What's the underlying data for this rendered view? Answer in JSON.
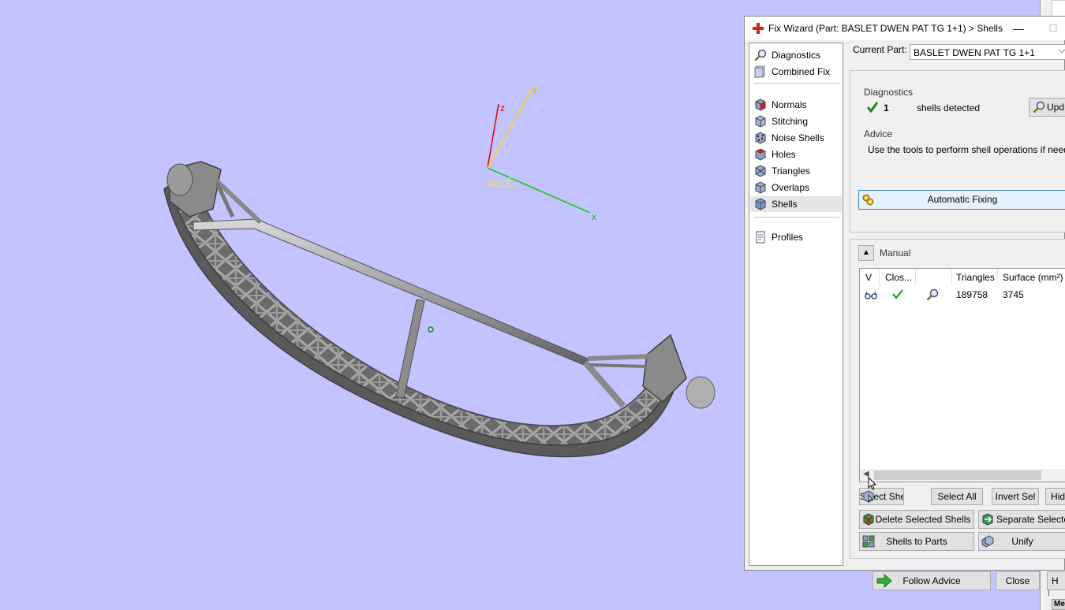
{
  "viewport": {
    "axes": {
      "z": "z",
      "y": "y",
      "x": "x",
      "wcs": "WCS"
    },
    "corner_axis": "x"
  },
  "window": {
    "title": "Fix Wizard (Part: BASLET  DWEN PAT TG 1+1) > Shells",
    "minimize": "—",
    "maximize": "☐"
  },
  "nav": {
    "top_items": [
      {
        "label": "Diagnostics",
        "icon": "magnifier-icon"
      },
      {
        "label": "Combined Fix",
        "icon": "combined-fix-icon"
      }
    ],
    "fix_items": [
      {
        "label": "Normals",
        "icon": "normals-icon"
      },
      {
        "label": "Stitching",
        "icon": "stitching-icon"
      },
      {
        "label": "Noise Shells",
        "icon": "noise-shells-icon"
      },
      {
        "label": "Holes",
        "icon": "holes-icon"
      },
      {
        "label": "Triangles",
        "icon": "triangles-icon"
      },
      {
        "label": "Overlaps",
        "icon": "overlaps-icon"
      },
      {
        "label": "Shells",
        "icon": "shells-icon",
        "selected": true
      }
    ],
    "bottom_items": [
      {
        "label": "Profiles",
        "icon": "profiles-icon"
      }
    ]
  },
  "current_part": {
    "label": "Current Part:",
    "value": "BASLET  DWEN PAT TG 1+1"
  },
  "diagnostics": {
    "title": "Diagnostics",
    "count": "1",
    "text": "shells detected",
    "update_button": "Upd"
  },
  "advice": {
    "title": "Advice",
    "text": "Use the tools to perform shell operations if needed."
  },
  "automatic_fixing": {
    "label": "Automatic Fixing"
  },
  "manual": {
    "label": "Manual",
    "table": {
      "headers": [
        "V",
        "Clos...",
        "",
        "Triangles",
        "Surface (mm²)"
      ],
      "rows": [
        {
          "triangles": "189758",
          "surface": "3745"
        }
      ]
    }
  },
  "buttons": {
    "select_shells": "Select Shells",
    "select_all": "Select All",
    "invert_sel": "Invert Sel",
    "hide": "Hide",
    "delete_selected": "Delete Selected Shells",
    "separate_selected": "Separate Selected",
    "shells_to_parts": "Shells to Parts",
    "unify": "Unify",
    "follow_advice": "Follow Advice",
    "close": "Close",
    "help": "H"
  },
  "background_window": {
    "tab_label": "Me"
  }
}
